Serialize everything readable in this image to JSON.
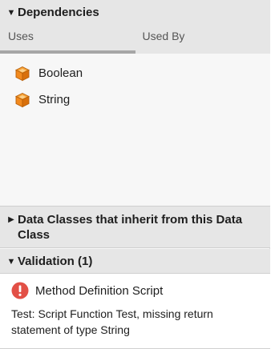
{
  "dependencies": {
    "title": "Dependencies",
    "tabs": [
      {
        "label": "Uses",
        "active": true
      },
      {
        "label": "Used By",
        "active": false
      }
    ],
    "items": [
      {
        "label": "Boolean",
        "icon": "data-class-cube-icon"
      },
      {
        "label": "String",
        "icon": "data-class-cube-icon"
      }
    ]
  },
  "inherit_section": {
    "title": "Data Classes that inherit from this Data Class",
    "collapsed": true
  },
  "validation": {
    "title": "Validation (1)",
    "entry_title": "Method Definition Script",
    "entry_message": "Test: Script Function Test, missing return statement of type String",
    "icon": "error-icon"
  },
  "colors": {
    "header_bg": "#e6e6e6",
    "cube_orange": "#f28a1e",
    "error_red": "#e25046"
  }
}
